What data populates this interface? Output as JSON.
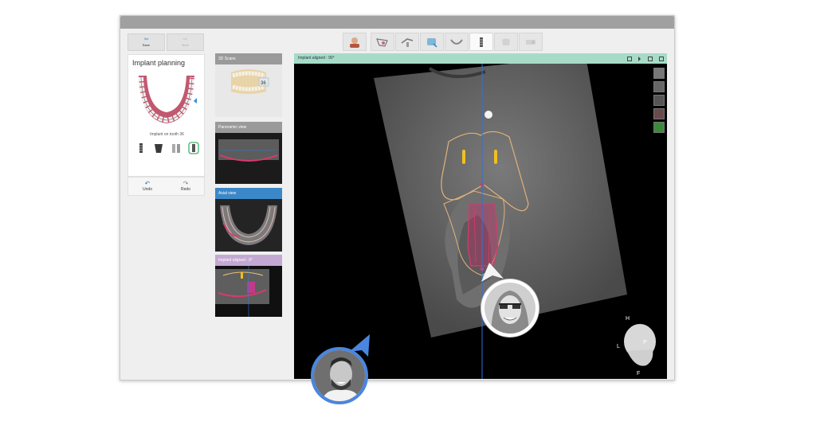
{
  "nav": {
    "back_label": "Back",
    "next_label": "Next"
  },
  "toolbar": {
    "tools": [
      {
        "icon": "patient-icon"
      },
      {
        "icon": "scan-icon"
      },
      {
        "icon": "margin-icon"
      },
      {
        "icon": "cbct-icon"
      },
      {
        "icon": "jaw-icon"
      },
      {
        "icon": "implant-icon"
      },
      {
        "icon": "crown-icon"
      },
      {
        "icon": "guide-icon"
      }
    ]
  },
  "left_panel": {
    "title": "Implant planning",
    "tooth_label": "Implant on tooth 36",
    "implant_icons": [
      "implant-screw-icon",
      "abutment-icon",
      "sleeve-icon",
      "guide-tube-icon"
    ],
    "undo_label": "Undo",
    "redo_label": "Redo"
  },
  "thumbnails": {
    "scans_title": "3D Scans",
    "scans_badge": "36",
    "panoramic_title": "Panoramic view",
    "axial_title": "Axial view",
    "implant_aligned_title": "Implant aligned : 0°"
  },
  "main_view": {
    "title": "Implant aligned : 90°",
    "orientation": {
      "top": "H",
      "left": "L",
      "right": "P",
      "bottom": "F"
    }
  },
  "colors": {
    "accent_blue": "#1f86d6",
    "header_green": "#a6dcc7",
    "header_violet": "#c4a8d4",
    "implant_red": "#d93a6b",
    "nerve_orange": "#e8c070"
  }
}
